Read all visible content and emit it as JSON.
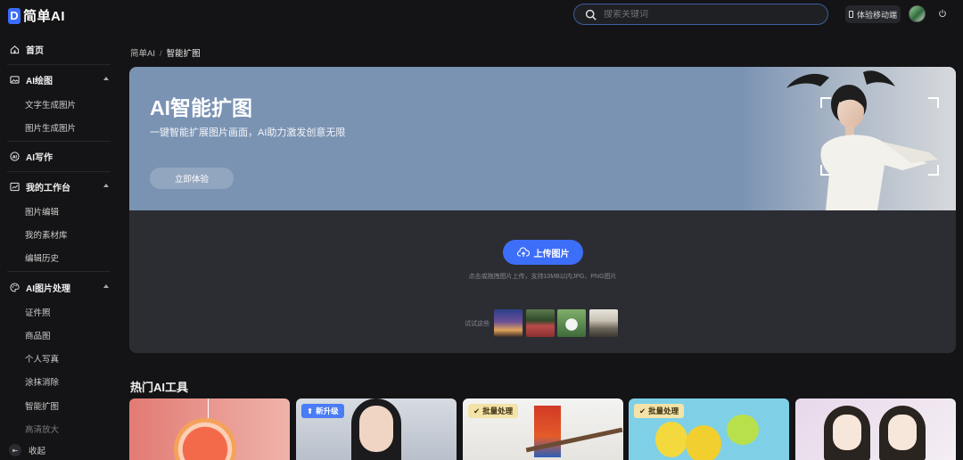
{
  "app": {
    "logo_letter": "D",
    "name": "简单AI"
  },
  "header": {
    "search_placeholder": "搜索关键词",
    "mobile_label": "体验移动端"
  },
  "sidebar": {
    "home": "首页",
    "ai_drawing": {
      "label": "AI绘图",
      "items": [
        "文字生成图片",
        "图片生成图片"
      ]
    },
    "ai_writing": "AI写作",
    "workspace": {
      "label": "我的工作台",
      "items": [
        "图片编辑",
        "我的素材库",
        "编辑历史"
      ]
    },
    "image_processing": {
      "label": "AI图片处理",
      "items": [
        "证件照",
        "商品图",
        "个人写真",
        "涂抹消除",
        "智能扩图",
        "高清放大"
      ]
    },
    "collapse": "收起"
  },
  "breadcrumb": {
    "root": "简单AI",
    "separator": "/",
    "current": "智能扩图"
  },
  "hero": {
    "title": "AI智能扩图",
    "subtitle": "一键智能扩展图片画面，AI助力激发创意无限",
    "cta": "立即体验"
  },
  "upload": {
    "button": "上传图片",
    "hint": "点击或拖拽图片上传，支持10MB以内JPG、PNG图片",
    "try_label": "试试这些"
  },
  "section": {
    "title": "热门AI工具"
  },
  "tool_tags": {
    "new": "新升级",
    "batch": "批量处理"
  },
  "colors": {
    "accent": "#3d6ef8",
    "hero_bg": "#7b93b3",
    "panel_bg": "#2c2d33",
    "page_bg": "#141416"
  }
}
